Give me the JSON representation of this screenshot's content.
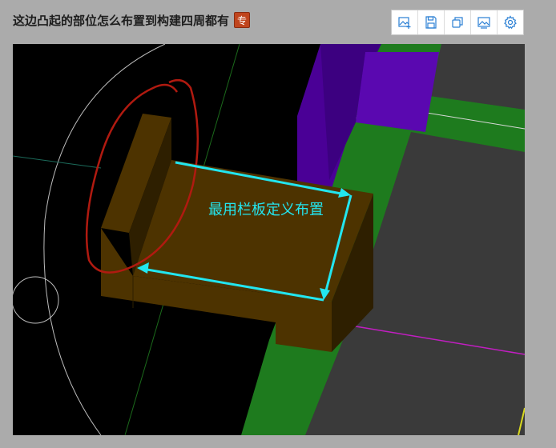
{
  "post": {
    "title": "这边凸起的部位怎么布置到构建四周都有",
    "badge": "专"
  },
  "toolbar": {
    "buttons": [
      {
        "name": "add-image-button",
        "icon": "image-add-icon"
      },
      {
        "name": "save-button",
        "icon": "save-icon"
      },
      {
        "name": "copy-button",
        "icon": "copy-icon"
      },
      {
        "name": "image-view-button",
        "icon": "image-view-icon"
      },
      {
        "name": "settings-button",
        "icon": "gear-icon"
      }
    ]
  },
  "viewport": {
    "annotation": "最用栏板定义布置",
    "colors": {
      "background": "#000000",
      "component": "#4d3300",
      "component_dark": "#2e1f00",
      "slab_green": "#1e7b1e",
      "slab_gray": "#3a3a3a",
      "wall_purple": "#4a0096",
      "arrow": "#22e6f0",
      "circle_mark": "#b01a10"
    }
  }
}
